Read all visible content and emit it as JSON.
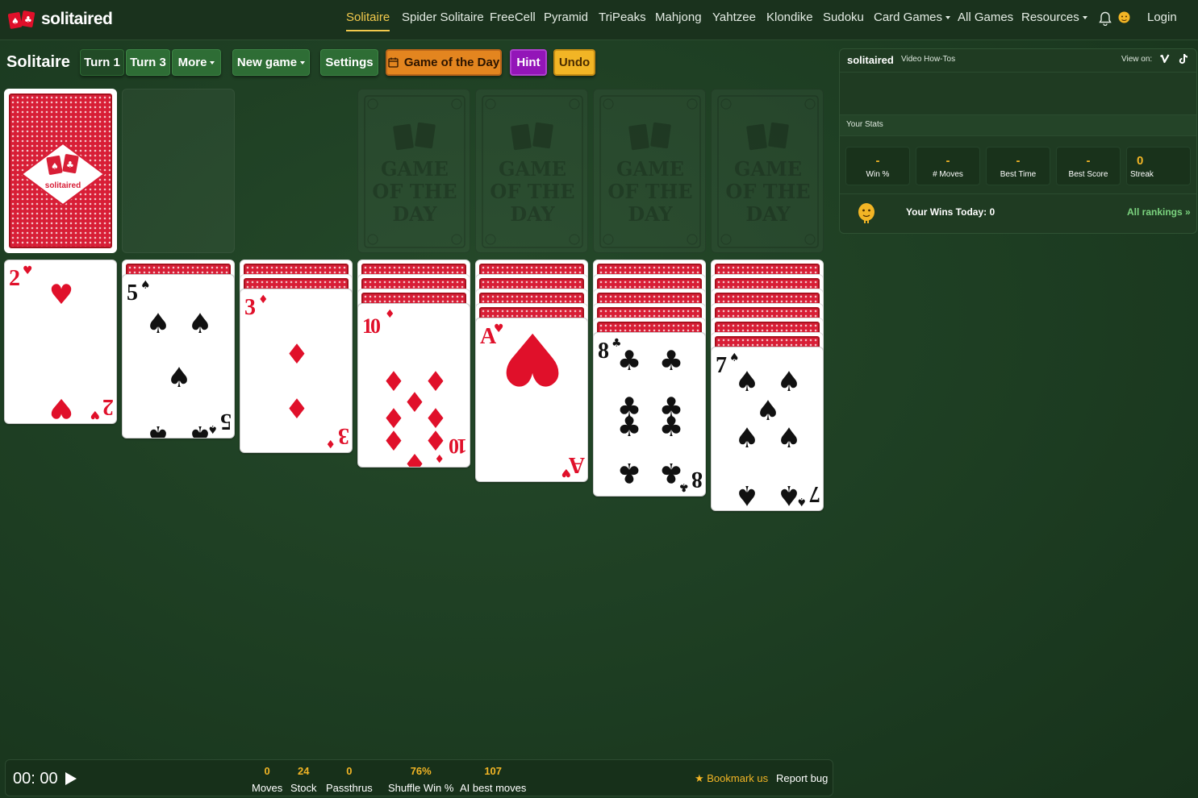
{
  "app": {
    "logo_text": "solitaired"
  },
  "nav": {
    "items": [
      {
        "label": "Solitaire",
        "active": true
      },
      {
        "label": "Spider Solitaire"
      },
      {
        "label": "FreeCell"
      },
      {
        "label": "Pyramid"
      },
      {
        "label": "TriPeaks"
      },
      {
        "label": "Mahjong"
      },
      {
        "label": "Yahtzee"
      },
      {
        "label": "Klondike"
      },
      {
        "label": "Sudoku"
      },
      {
        "label": "Card Games",
        "dropdown": true
      },
      {
        "label": "All Games"
      },
      {
        "label": "Resources",
        "dropdown": true
      }
    ],
    "login": "Login",
    "icons": [
      "bell-icon",
      "user-avatar-icon"
    ]
  },
  "toolbar": {
    "title": "Solitaire",
    "turn1": "Turn 1",
    "turn3": "Turn 3",
    "more": "More",
    "new_game": "New game",
    "settings": "Settings",
    "game_of_day": "Game of the Day",
    "hint": "Hint",
    "undo": "Undo"
  },
  "colors": {
    "accent": "#f2b525",
    "red": "#e0102a",
    "hint": "#9315b8",
    "gotd": "#e3851f"
  },
  "foundation": {
    "placeholder": "GAME OF THE DAY"
  },
  "tableau": [
    {
      "face_down": 0,
      "top": {
        "rank": "2",
        "suit": "♥"
      }
    },
    {
      "face_down": 1,
      "top": {
        "rank": "5",
        "suit": "♠"
      }
    },
    {
      "face_down": 2,
      "top": {
        "rank": "3",
        "suit": "♦"
      }
    },
    {
      "face_down": 3,
      "top": {
        "rank": "10",
        "suit": "♦"
      }
    },
    {
      "face_down": 4,
      "top": {
        "rank": "A",
        "suit": "♥"
      }
    },
    {
      "face_down": 5,
      "top": {
        "rank": "8",
        "suit": "♣"
      }
    },
    {
      "face_down": 6,
      "top": {
        "rank": "7",
        "suit": "♠"
      }
    }
  ],
  "panel": {
    "brand": "solitaired",
    "video_label": "Video How-Tos",
    "view_on": "View on:",
    "social_icons": [
      "vimeo-icon",
      "tiktok-icon"
    ],
    "stats_header": "Your Stats",
    "stats": [
      {
        "value": "-",
        "label": "Win %"
      },
      {
        "value": "-",
        "label": "# Moves"
      },
      {
        "value": "-",
        "label": "Best Time"
      },
      {
        "value": "-",
        "label": "Best Score"
      },
      {
        "value": "0",
        "label": "Streak"
      }
    ],
    "wins_today": "Your Wins Today: 0",
    "rankings_link": "All rankings »"
  },
  "status": {
    "timer": "00: 00",
    "stats": [
      {
        "value": "0",
        "label": "Moves"
      },
      {
        "value": "24",
        "label": "Stock"
      },
      {
        "value": "0",
        "label": "Passthrus"
      },
      {
        "value": "76%",
        "label": "Shuffle Win %"
      },
      {
        "value": "107",
        "label": "AI best moves"
      }
    ],
    "bookmark": "★ Bookmark us",
    "report": "Report bug"
  }
}
